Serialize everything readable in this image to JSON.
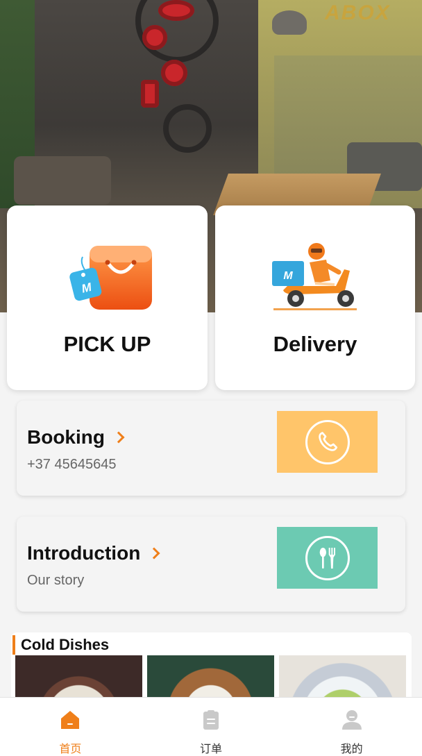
{
  "hero": {
    "sign_text": "ABOX"
  },
  "cards": {
    "pickup_label": "PICK UP",
    "delivery_label": "Delivery"
  },
  "booking": {
    "title": "Booking",
    "subtitle": "+37 45645645",
    "icon": "phone-icon",
    "tile_color": "#ffc56a"
  },
  "introduction": {
    "title": "Introduction",
    "subtitle": "Our story",
    "icon": "utensils-icon",
    "tile_color": "#6ccab2"
  },
  "dishes": {
    "section_title": "Cold Dishes"
  },
  "nav": {
    "items": [
      {
        "label": "首页",
        "icon": "home-icon",
        "active": true
      },
      {
        "label": "订单",
        "icon": "orders-icon",
        "active": false
      },
      {
        "label": "我的",
        "icon": "profile-icon",
        "active": false
      }
    ]
  },
  "colors": {
    "accent": "#ef7f1a"
  }
}
